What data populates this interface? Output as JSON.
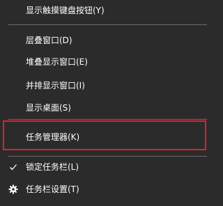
{
  "menu": {
    "items": {
      "touch_keyboard": {
        "label": "显示触摸键盘按钮(Y)"
      },
      "cascade": {
        "label": "层叠窗口(D)"
      },
      "stacked": {
        "label": "堆叠显示窗口(E)"
      },
      "side_by_side": {
        "label": "并排显示窗口(I)"
      },
      "show_desktop": {
        "label": "显示桌面(S)"
      },
      "task_manager": {
        "label": "任务管理器(K)"
      },
      "lock_taskbar": {
        "label": "锁定任务栏(L)",
        "checked": true
      },
      "taskbar_settings": {
        "label": "任务栏设置(T)"
      }
    },
    "icons": {
      "lock_taskbar": "checkmark-icon",
      "taskbar_settings": "gear-icon"
    },
    "colors": {
      "background": "#2b2b2b",
      "text": "#ffffff",
      "separator": "#6a6a6a",
      "highlight_border": "#e0202e"
    }
  }
}
